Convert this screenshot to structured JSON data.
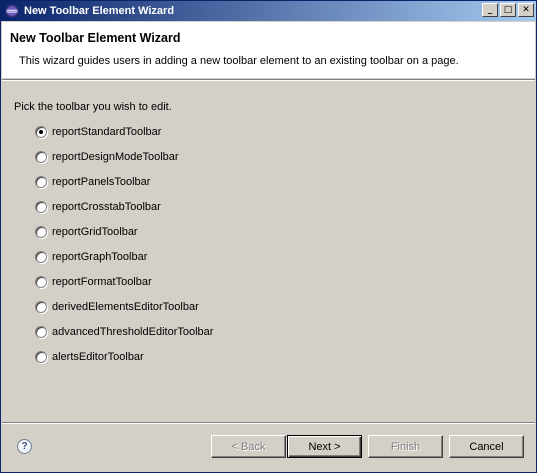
{
  "window": {
    "title": "New Toolbar Element Wizard",
    "minimize_label": "_",
    "maximize_label": "□",
    "close_label": "✕"
  },
  "header": {
    "title": "New Toolbar Element Wizard",
    "description": "This wizard guides users in adding a new toolbar element to an existing toolbar on a page."
  },
  "main": {
    "prompt": "Pick the toolbar you wish to edit.",
    "selected_index": 0,
    "options": [
      {
        "label": "reportStandardToolbar",
        "checked": true
      },
      {
        "label": "reportDesignModeToolbar",
        "checked": false
      },
      {
        "label": "reportPanelsToolbar",
        "checked": false
      },
      {
        "label": "reportCrosstabToolbar",
        "checked": false
      },
      {
        "label": "reportGridToolbar",
        "checked": false
      },
      {
        "label": "reportGraphToolbar",
        "checked": false
      },
      {
        "label": "reportFormatToolbar",
        "checked": false
      },
      {
        "label": "derivedElementsEditorToolbar",
        "checked": false
      },
      {
        "label": "advancedThresholdEditorToolbar",
        "checked": false
      },
      {
        "label": "alertsEditorToolbar",
        "checked": false
      }
    ]
  },
  "footer": {
    "help_icon": "help-icon",
    "help_label": "?",
    "back_label": "< Back",
    "next_label": "Next >",
    "finish_label": "Finish",
    "cancel_label": "Cancel"
  },
  "colors": {
    "title_bar_start": "#0a246a",
    "title_bar_end": "#a6caf0",
    "dialog_face": "#d4d0c8",
    "header_bg": "#ffffff",
    "disabled_text": "#808080"
  }
}
